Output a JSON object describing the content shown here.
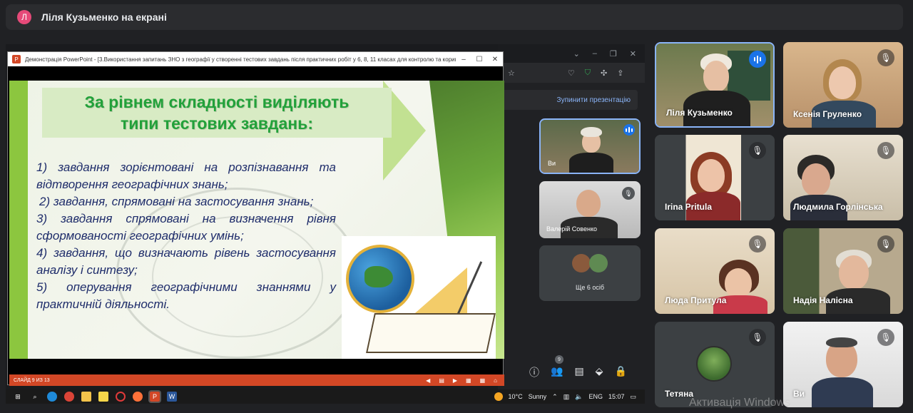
{
  "banner": {
    "avatar_letter": "Л",
    "presenter_text": "Ліля Кузьменко на екрані"
  },
  "powerpoint": {
    "window_title": "Демонстрація PowerPoint - [3.Використання запитань ЗНО з географії у створенні тестових завдань після практичних робіт у 6, 8, 11 класах для контролю та коригува...",
    "slide_title_lines": [
      "За рівнем складності виділяють",
      "типи тестових завдань:"
    ],
    "slide_body": [
      "1) завдання зорієнтовані на розпізнавання та відтворення географічних знань;",
      "2) завдання, спрямовані на застосування знань;",
      "3) завдання спрямовані на визначення рівня сформованості географічних умінь;",
      "4) завдання, що визначають рівень застосування аналізу і синтезу;",
      "5) оперування географічними знаннями у практичній діяльності."
    ],
    "status_text": "СЛАЙД 9 ИЗ 13"
  },
  "background_meet": {
    "stop_button": "Зупинити презентацію",
    "self_label": "Ви",
    "mini_participant": "Валерій Совенко",
    "more_label": "Ще 6 осіб",
    "people_badge": "9"
  },
  "taskbar": {
    "temperature": "10°C",
    "weather": "Sunny",
    "lang": "ENG",
    "time": "15:07"
  },
  "participants": [
    {
      "name": "Ліля Кузьменко",
      "speaking": true
    },
    {
      "name": "Ксенія Груленко",
      "muted": true
    },
    {
      "name": "Irina Pritula",
      "muted": true
    },
    {
      "name": "Людмила Горлінська",
      "muted": true
    },
    {
      "name": "Люда Притула",
      "muted": true
    },
    {
      "name": "Надія Налісна",
      "muted": true
    },
    {
      "name": "Тетяна",
      "muted": true
    },
    {
      "name": "Ви",
      "muted": true
    }
  ],
  "watermark": "Активація Windows",
  "colors": {
    "accent": "#8ab4f8",
    "ppt": "#d24726",
    "title_green": "#22a13a",
    "body_blue": "#1f2d6b",
    "speaking": "#1a73e8"
  }
}
